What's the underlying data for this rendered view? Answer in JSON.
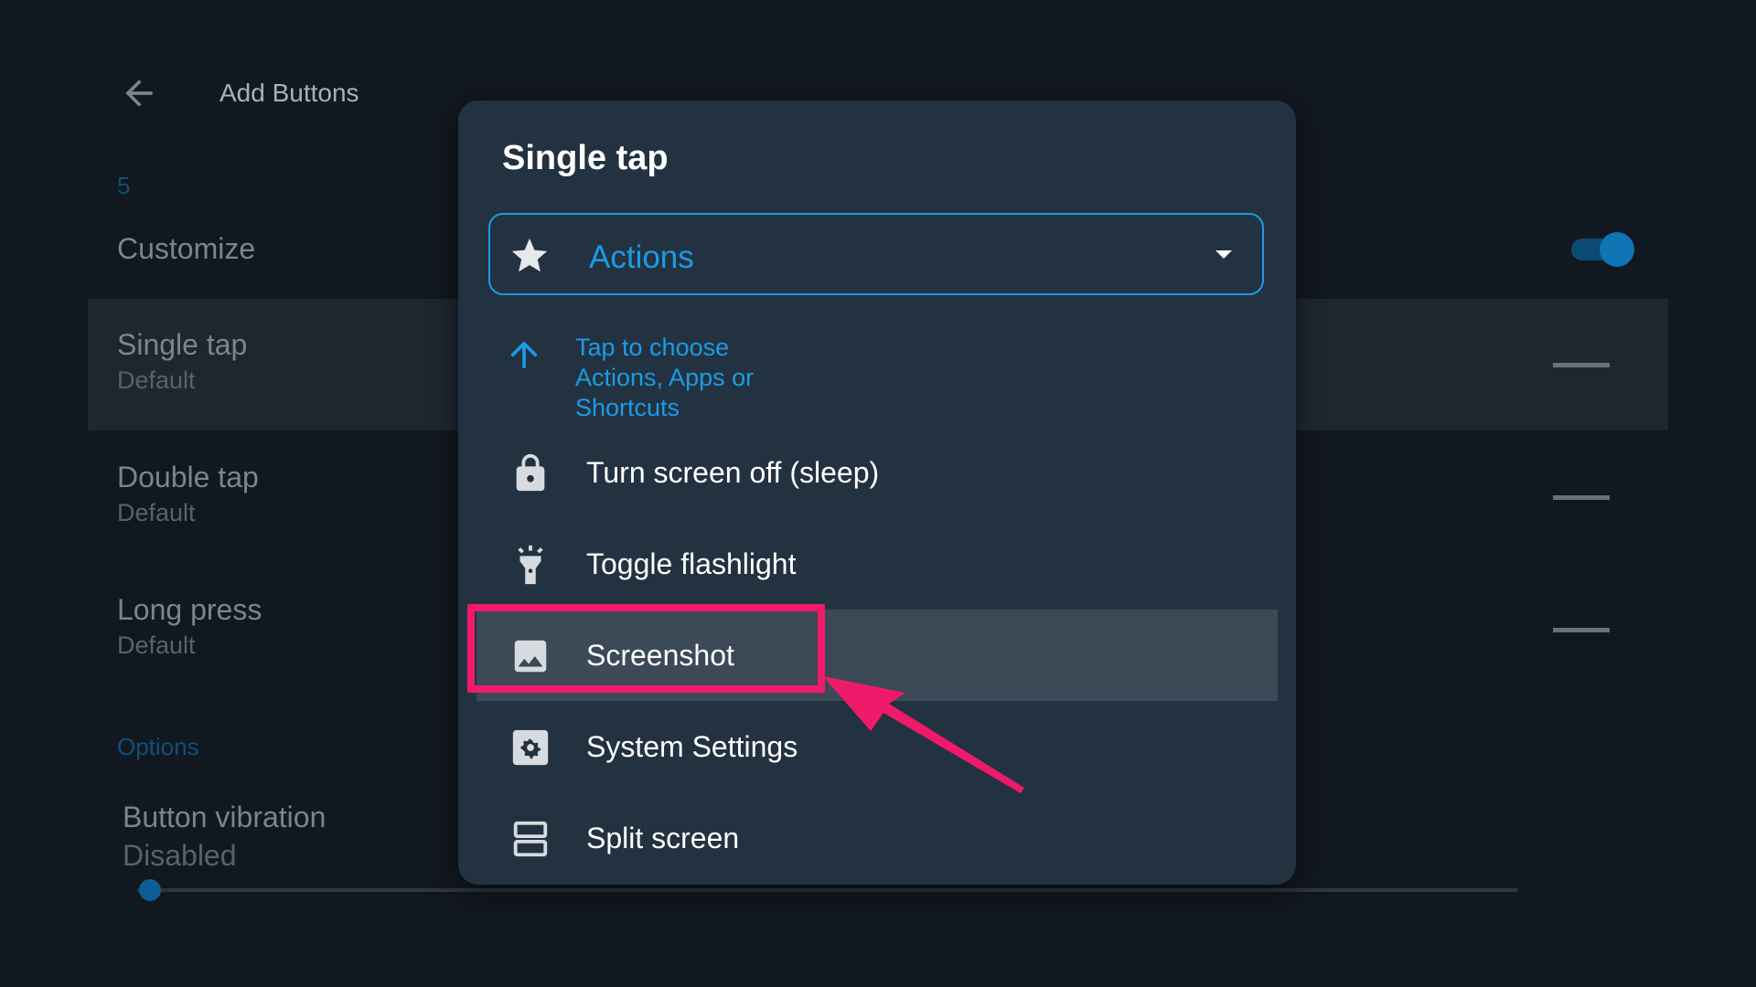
{
  "app": {
    "title": "Add Buttons",
    "count": "5",
    "customize_label": "Customize",
    "toggle_on": true,
    "rows": [
      {
        "title": "Single tap",
        "subtitle": "Default"
      },
      {
        "title": "Double tap",
        "subtitle": "Default"
      },
      {
        "title": "Long press",
        "subtitle": "Default"
      }
    ],
    "options_label": "Options",
    "vibration": {
      "title": "Button vibration",
      "subtitle": "Disabled",
      "level": 0
    }
  },
  "dialog": {
    "title": "Single tap",
    "dropdown": {
      "icon": "star-icon",
      "value": "Actions"
    },
    "hint": {
      "icon": "arrow-up-icon",
      "lines": [
        "Tap to choose",
        "Actions, Apps or",
        "Shortcuts"
      ]
    },
    "items": [
      {
        "label": "Turn screen off (sleep)",
        "icon": "lock-icon"
      },
      {
        "label": "Toggle flashlight",
        "icon": "flashlight-icon"
      },
      {
        "label": "Screenshot",
        "icon": "image-icon",
        "highlighted": true
      },
      {
        "label": "System Settings",
        "icon": "settings-gear-icon"
      },
      {
        "label": "Split screen",
        "icon": "split-screen-icon"
      }
    ]
  },
  "colors": {
    "accent": "#1b9be6",
    "dialog_bg": "#233240",
    "background": "#121820",
    "annotation": "#f0196a"
  }
}
